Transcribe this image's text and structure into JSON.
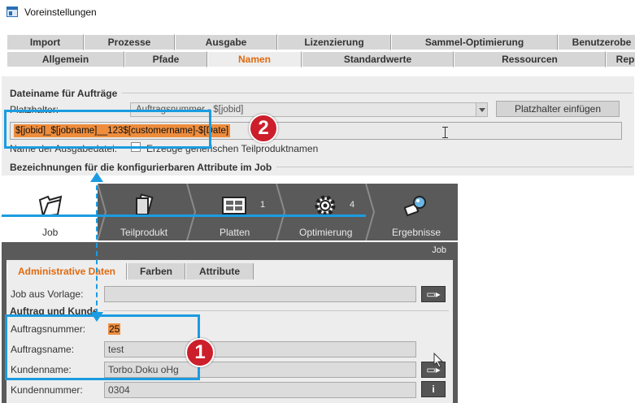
{
  "window": {
    "title": "Voreinstellungen"
  },
  "tabs_row1": [
    {
      "label": "Import",
      "width": 95
    },
    {
      "label": "Prozesse",
      "width": 112
    },
    {
      "label": "Ausgabe",
      "width": 126
    },
    {
      "label": "Lizenzierung",
      "width": 140
    },
    {
      "label": "Sammel-Optimierung",
      "width": 205
    },
    {
      "label": "Benutzerobe",
      "width": 108
    }
  ],
  "tabs_row2": [
    {
      "label": "Allgemein",
      "width": 145
    },
    {
      "label": "Pfade",
      "width": 102
    },
    {
      "label": "Namen",
      "width": 116,
      "active": true
    },
    {
      "label": "Standardwerte",
      "width": 187
    },
    {
      "label": "Ressourcen",
      "width": 187
    },
    {
      "label": "Rep",
      "width": 48
    }
  ],
  "filename_section": {
    "title": "Dateiname für Aufträge",
    "placeholder_label": "Platzhalter:",
    "placeholder_value": "Auftragsnummer - $[jobid]",
    "insert_button": "Platzhalter einfügen",
    "template_value": "$[jobid]_$[jobname]__123$[customername]-$[Date]",
    "output_name_label": "Name der Ausgabedatei:",
    "checkbox_label": "Erzeuge generischen Teilproduktnamen"
  },
  "attributes_section": {
    "title": "Bezeichnungen für die konfigurierbaren Attribute im Job"
  },
  "workflow_steps": [
    {
      "name": "Job",
      "count": "",
      "active": true
    },
    {
      "name": "Teilprodukt",
      "count": ""
    },
    {
      "name": "Platten",
      "count": "1"
    },
    {
      "name": "Optimierung",
      "count": "4"
    },
    {
      "name": "Ergebnisse",
      "count": ""
    }
  ],
  "job_panel": {
    "caption": "Job",
    "subtabs": [
      {
        "label": "Administrative Daten",
        "active": true
      },
      {
        "label": "Farben"
      },
      {
        "label": "Attribute"
      }
    ],
    "template_label": "Job aus Vorlage:",
    "template_value": "",
    "order_section": "Auftrag und Kunde",
    "fields": [
      {
        "label": "Auftragsnummer:",
        "value": "25",
        "selected": true
      },
      {
        "label": "Auftragsname:",
        "value": "test"
      },
      {
        "label": "Kundenname:",
        "value": "Torbo.Doku oHg"
      },
      {
        "label": "Kundennummer:",
        "value": "0304"
      }
    ],
    "info_button": "i"
  },
  "callouts": {
    "one": "1",
    "two": "2"
  },
  "colors": {
    "accent": "#e06a10",
    "highlight": "#1b9ce0",
    "badge": "#cc1f2b",
    "selection": "#ee8d3d"
  }
}
